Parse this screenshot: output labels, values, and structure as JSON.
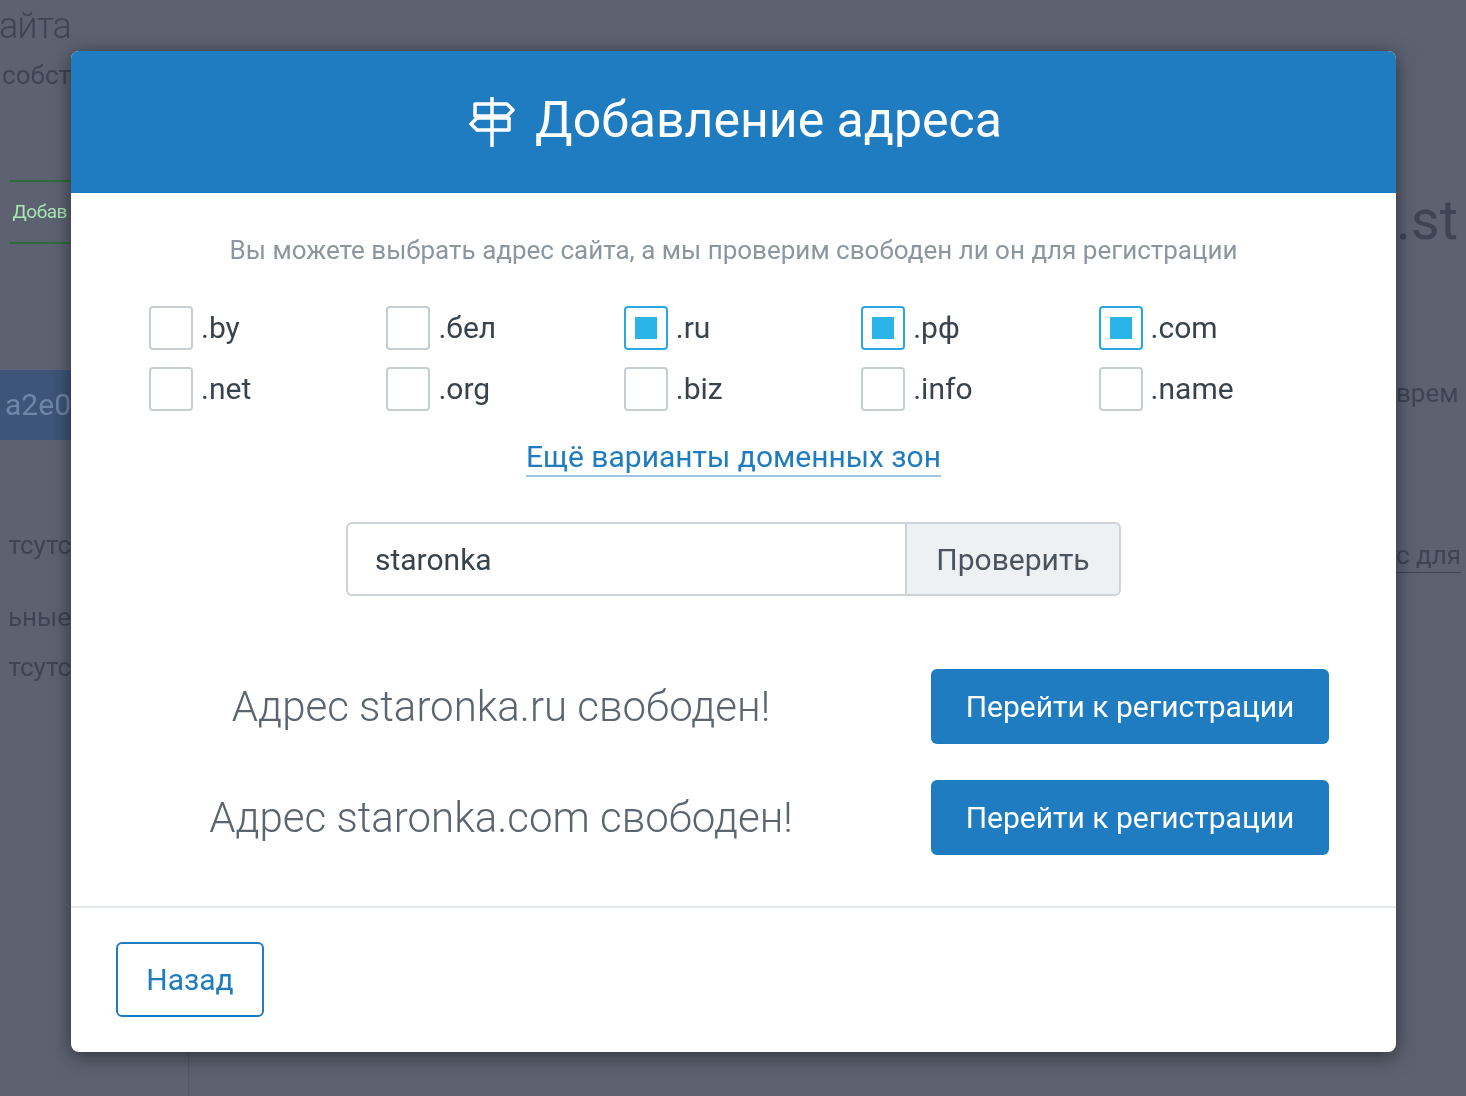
{
  "background": {
    "left": [
      {
        "kind": "heading",
        "text": "айта"
      },
      {
        "kind": "text",
        "text": "собст"
      },
      {
        "kind": "button",
        "text": "Добав"
      },
      {
        "kind": "row",
        "text": "а2е0"
      },
      {
        "kind": "text",
        "text": "тсутс"
      },
      {
        "kind": "text",
        "text": "ьные"
      },
      {
        "kind": "text",
        "text": "тсутс"
      }
    ],
    "right": [
      {
        "kind": "heading",
        "text": ".st"
      },
      {
        "kind": "text",
        "text": "врем"
      },
      {
        "kind": "link",
        "text": "с для"
      }
    ]
  },
  "dialog": {
    "title": "Добавление адреса",
    "subtitle": "Вы можете выбрать адрес сайта, а мы проверим свободен ли он для регистрации",
    "domains": [
      {
        "label": ".by",
        "checked": false
      },
      {
        "label": ".бел",
        "checked": false
      },
      {
        "label": ".ru",
        "checked": true
      },
      {
        "label": ".рф",
        "checked": true
      },
      {
        "label": ".com",
        "checked": true
      },
      {
        "label": ".net",
        "checked": false
      },
      {
        "label": ".org",
        "checked": false
      },
      {
        "label": ".biz",
        "checked": false
      },
      {
        "label": ".info",
        "checked": false
      },
      {
        "label": ".name",
        "checked": false
      }
    ],
    "more_link": "Ещё варианты доменных зон",
    "search": {
      "value": "staronka",
      "button": "Проверить"
    },
    "results": [
      {
        "text": "Адрес staronka.ru свободен!",
        "button": "Перейти к регистрации"
      },
      {
        "text": "Адрес staronka.com свободен!",
        "button": "Перейти к регистрации"
      }
    ],
    "back_button": "Назад"
  }
}
